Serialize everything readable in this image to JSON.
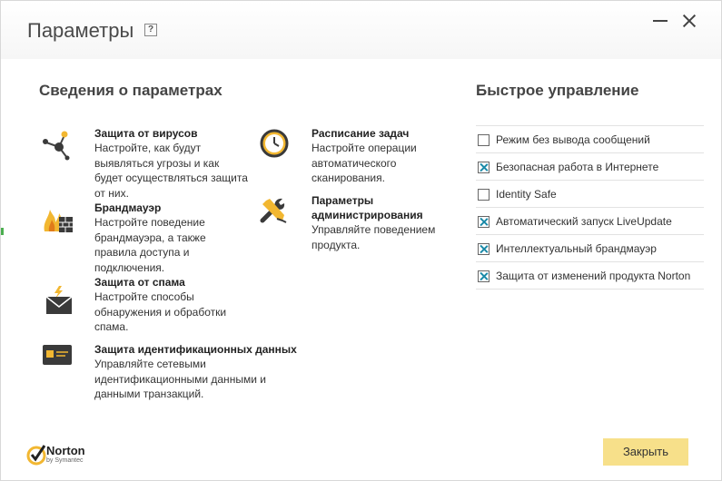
{
  "window": {
    "title": "Параметры",
    "help": "?"
  },
  "settings_info": {
    "heading": "Сведения о параметрах",
    "features": [
      {
        "name": "Защита от вирусов",
        "desc": [
          "Настройте, как будут",
          "выявляться угрозы и как",
          "будет осуществляться защита",
          "от них."
        ]
      },
      {
        "name": "Брандмауэр",
        "desc": [
          "Настройте поведение",
          "брандмауэра, а также",
          "правила доступа и",
          "подключения."
        ]
      },
      {
        "name": "Защита от спама",
        "desc": [
          "Настройте способы",
          "обнаружения и обработки",
          "спама."
        ]
      },
      {
        "name": "Защита идентификационных данных",
        "desc": [
          "Управляйте сетевыми",
          "идентификационными данными и",
          "данными транзакций."
        ]
      },
      {
        "name": "Расписание задач",
        "desc": [
          "Настройте операции",
          "автоматического",
          "сканирования."
        ]
      },
      {
        "name": [
          "Параметры",
          "администрирования"
        ],
        "desc": [
          "Управляйте поведением",
          "продукта."
        ]
      }
    ]
  },
  "quick_controls": {
    "heading": "Быстрое управление",
    "items": [
      {
        "label": "Режим без вывода сообщений",
        "checked": false
      },
      {
        "label": "Безопасная работа в Интернете",
        "checked": true
      },
      {
        "label": "Identity Safe",
        "checked": false
      },
      {
        "label": "Автоматический запуск LiveUpdate",
        "checked": true
      },
      {
        "label": "Интеллектуальный брандмауэр",
        "checked": true
      },
      {
        "label": "Защита от изменений продукта Norton",
        "checked": true
      }
    ]
  },
  "footer": {
    "logo_text": "Norton",
    "logo_sub": "by Symantec",
    "close_label": "Закрыть",
    "accent": "#f7e08a"
  },
  "icons": [
    "help-icon",
    "minimize-icon",
    "close-icon",
    "virus-protection-icon",
    "firewall-icon",
    "spam-icon",
    "identity-icon",
    "schedule-clock-icon",
    "admin-tools-icon",
    "norton-check-icon"
  ]
}
